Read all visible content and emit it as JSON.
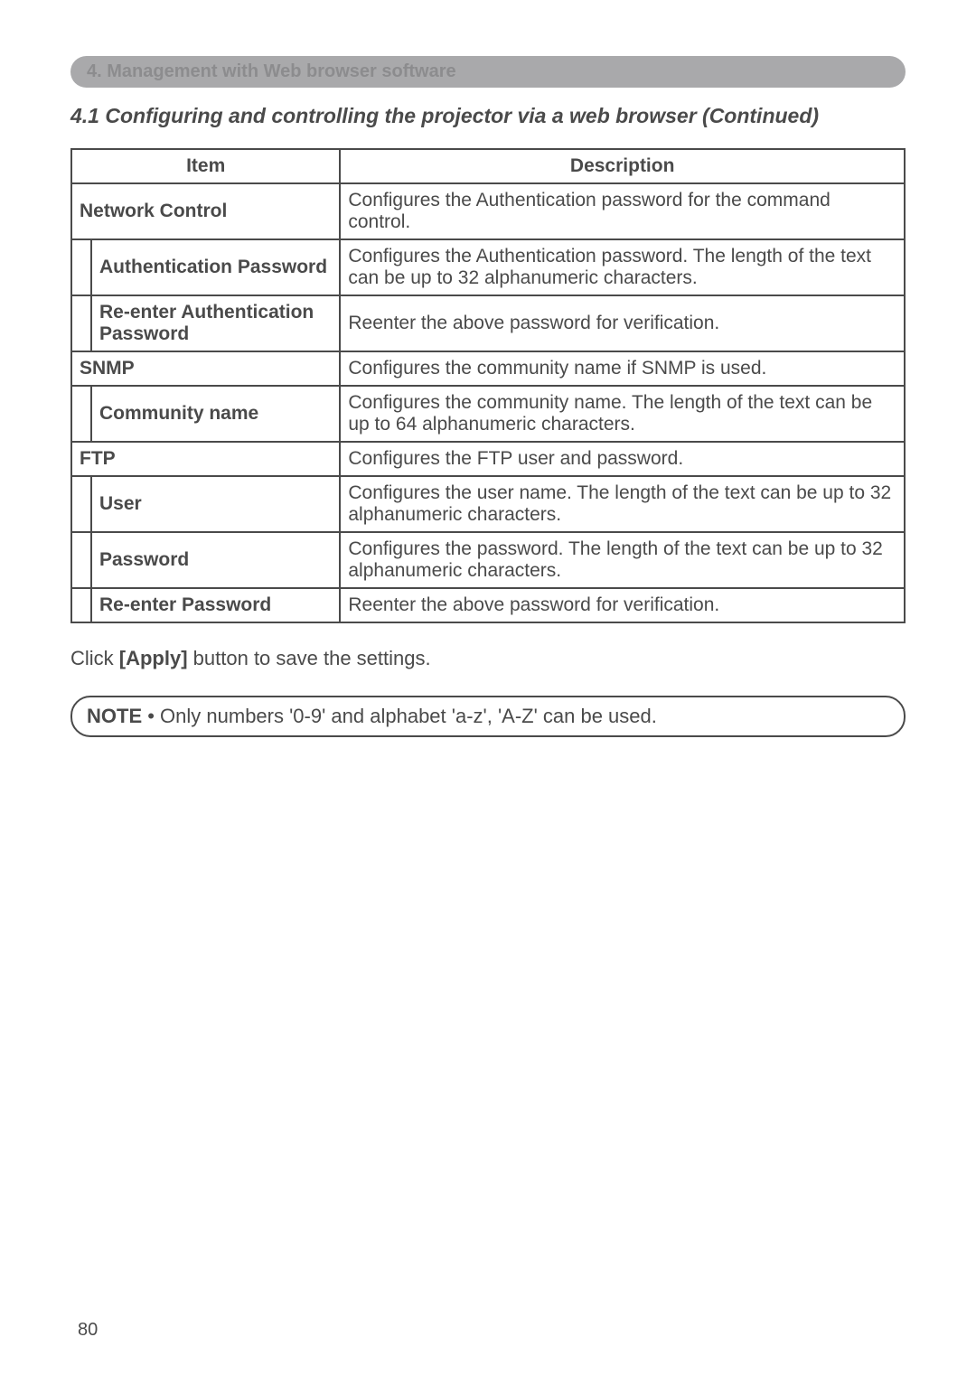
{
  "chapter_banner": "4. Management with Web browser software",
  "section_title": "4.1 Configuring and controlling the projector via a web browser (Continued)",
  "table": {
    "headers": {
      "item": "Item",
      "description": "Description"
    },
    "rows": [
      {
        "type": "main",
        "item": "Network Control",
        "desc": "Configures the Authentication password for the command control."
      },
      {
        "type": "sub",
        "item": "Authentication Password",
        "desc": "Configures the Authentication password. The length of the text can be up to 32 alphanumeric characters."
      },
      {
        "type": "sub",
        "item": "Re-enter Authentication Password",
        "desc": "Reenter the above password for verification."
      },
      {
        "type": "main",
        "item": "SNMP",
        "desc": "Configures the community name if SNMP is used."
      },
      {
        "type": "sub",
        "item": "Community name",
        "desc": "Configures the community name. The length of the text can be up to 64 alphanumeric characters."
      },
      {
        "type": "main",
        "item": "FTP",
        "desc": "Configures the FTP user and password."
      },
      {
        "type": "sub",
        "item": "User",
        "desc": "Configures the user name. The length of the text can be up to 32 alphanumeric characters."
      },
      {
        "type": "sub",
        "item": "Password",
        "desc": "Configures the password. The length of the text can be up to 32 alphanumeric characters."
      },
      {
        "type": "sub",
        "item": "Re-enter Password",
        "desc": "Reenter the above password for verification."
      }
    ]
  },
  "apply_text": {
    "pre": "Click ",
    "bold": "[Apply]",
    "post": " button to save the settings."
  },
  "note": {
    "label": "NOTE",
    "text": " • Only numbers '0-9' and alphabet 'a-z', 'A-Z' can be used."
  },
  "page_number": "80"
}
